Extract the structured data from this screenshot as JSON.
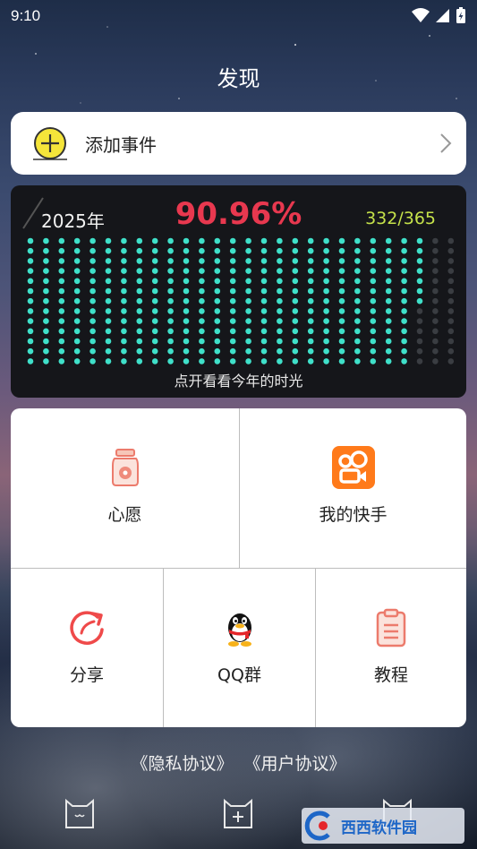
{
  "status_bar": {
    "time": "9:10"
  },
  "header": {
    "title": "发现"
  },
  "add_event": {
    "label": "添加事件"
  },
  "year_progress": {
    "year": "2025年",
    "percent_text": "90.96%",
    "count_text": "332/365",
    "days_elapsed": 332,
    "days_total": 365,
    "caption": "点开看看今年的时光",
    "colors": {
      "filled": "#3fe0c9",
      "empty": "#3a3d42",
      "percent": "#e8384f",
      "count": "#c5e24a"
    }
  },
  "grid": {
    "wish": {
      "label": "心愿",
      "icon": "jar-icon"
    },
    "kuaishou": {
      "label": "我的快手",
      "icon": "kuaishou-icon"
    },
    "share": {
      "label": "分享",
      "icon": "share-icon"
    },
    "qq_group": {
      "label": "QQ群",
      "icon": "qq-penguin-icon"
    },
    "tutorial": {
      "label": "教程",
      "icon": "clipboard-icon"
    }
  },
  "footer_links": {
    "privacy": "《隐私协议》",
    "user": "《用户协议》"
  }
}
